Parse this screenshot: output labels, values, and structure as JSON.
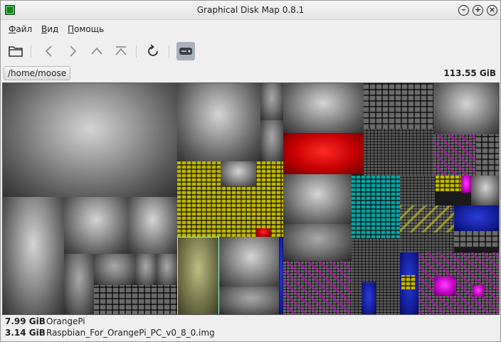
{
  "window": {
    "title": "Graphical Disk Map 0.8.1"
  },
  "menu": {
    "items": [
      {
        "label": "Файл"
      },
      {
        "label": "Вид"
      },
      {
        "label": "Помощь"
      }
    ]
  },
  "path": {
    "current": "/home/moose",
    "total_size": "113.55 GiB"
  },
  "status": {
    "rows": [
      {
        "size": "7.99 GiB",
        "name": "OrangePi"
      },
      {
        "size": "3.14 GiB",
        "name": "Raspbian_For_OrangePi_PC_v0_8_0.img"
      }
    ]
  },
  "icons": {
    "open": "folder-icon",
    "back": "chevron-left-icon",
    "forward": "chevron-right-icon",
    "up": "chevron-up-icon",
    "top": "go-top-icon",
    "reload": "reload-icon",
    "drive": "drive-icon"
  },
  "colors": {
    "accent_red": "#c40000",
    "accent_yellow": "#d9d400",
    "accent_cyan": "#19c7c7",
    "accent_blue": "#101a90",
    "accent_magenta": "#c000c0"
  }
}
